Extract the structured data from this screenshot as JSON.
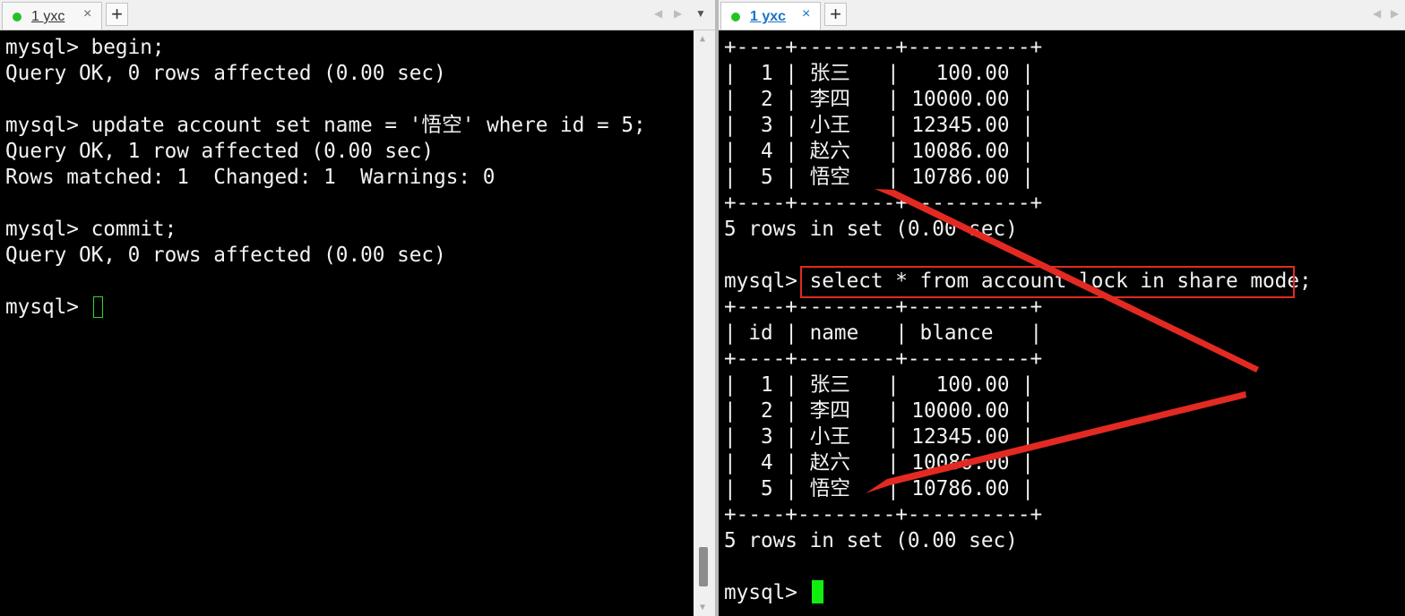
{
  "left_pane": {
    "tab": {
      "title": "1 yxc",
      "close": "×",
      "add": "+",
      "nav_prev": "◀",
      "nav_next": "▶",
      "menu": "▼"
    },
    "scrollbar": {
      "up": "▲",
      "down": "▼"
    },
    "lines": [
      "mysql> begin;",
      "Query OK, 0 rows affected (0.00 sec)",
      "",
      "mysql> update account set name = '悟空' where id = 5;",
      "Query OK, 1 row affected (0.00 sec)",
      "Rows matched: 1  Changed: 1  Warnings: 0",
      "",
      "mysql> commit;",
      "Query OK, 0 rows affected (0.00 sec)",
      "",
      "mysql> "
    ]
  },
  "right_pane": {
    "tab": {
      "title": "1 yxc",
      "close": "×",
      "add": "+",
      "nav_prev": "◀",
      "nav_next": "▶"
    },
    "lines": [
      "+----+--------+----------+",
      "|  1 | 张三   |   100.00 |",
      "|  2 | 李四   | 10000.00 |",
      "|  3 | 小王   | 12345.00 |",
      "|  4 | 赵六   | 10086.00 |",
      "|  5 | 悟空   | 10786.00 |",
      "+----+--------+----------+",
      "5 rows in set (0.00 sec)",
      "",
      "mysql> select * from account lock in share mode;",
      "+----+--------+----------+",
      "| id | name   | blance   |",
      "+----+--------+----------+",
      "|  1 | 张三   |   100.00 |",
      "|  2 | 李四   | 10000.00 |",
      "|  3 | 小王   | 12345.00 |",
      "|  4 | 赵六   | 10086.00 |",
      "|  5 | 悟空   | 10786.00 |",
      "+----+--------+----------+",
      "5 rows in set (0.00 sec)",
      "",
      "mysql> "
    ]
  },
  "colors": {
    "tab_dot": "#25c225",
    "cursor": "#10ee10",
    "annotation": "#e22a22"
  }
}
